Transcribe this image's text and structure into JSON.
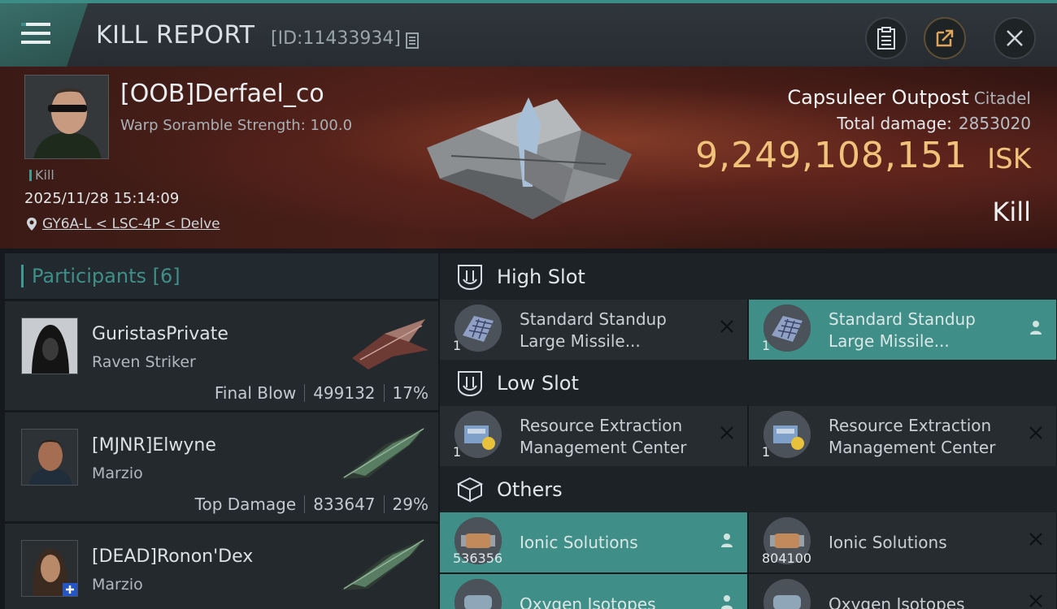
{
  "header": {
    "title": "KILL REPORT",
    "report_id": "[ID:11433934]"
  },
  "victim": {
    "pilot": "[OOB]Derfael_co",
    "scramble": "Warp Soramble Strength: 100.0",
    "kill_tag": "Kill",
    "datetime": "2025/11/28 15:14:09",
    "location": "GY6A-L < LSC-4P < Delve",
    "structure": "Capsuleer Outpost",
    "structure_class": "Citadel",
    "total_damage_label": "Total damage:",
    "total_damage": "2853020",
    "isk_value": "9,249,108,151",
    "isk_unit": "ISK",
    "result": "Kill"
  },
  "participants": {
    "label": "Participants",
    "count": "[6]",
    "rows": [
      {
        "name": "GuristasPrivate",
        "ship": "Raven Striker",
        "tag": "Final Blow",
        "damage": "499132",
        "percent": "17%"
      },
      {
        "name": "[MJNR]Elwyne",
        "ship": "Marzio",
        "tag": "Top Damage",
        "damage": "833647",
        "percent": "29%"
      },
      {
        "name": "[DEAD]Ronon'Dex",
        "ship": "Marzio"
      }
    ]
  },
  "slots": {
    "high": {
      "title": "High Slot",
      "items": [
        {
          "name1": "Standard Standup",
          "name2": "Large Missile...",
          "qty": "1"
        },
        {
          "name1": "Standard Standup",
          "name2": "Large Missile...",
          "qty": "1"
        }
      ]
    },
    "low": {
      "title": "Low Slot",
      "items": [
        {
          "name1": "Resource Extraction",
          "name2": "Management Center",
          "qty": "1"
        },
        {
          "name1": "Resource Extraction",
          "name2": "Management Center",
          "qty": "1"
        }
      ]
    },
    "others": {
      "title": "Others",
      "items": [
        {
          "name": "Ionic Solutions",
          "qty": "536356"
        },
        {
          "name": "Ionic Solutions",
          "qty": "804100"
        },
        {
          "name": "Oxygen Isotopes"
        },
        {
          "name": "Oxygen Isotopes"
        }
      ]
    }
  },
  "colors": {
    "accent": "#3f8f88",
    "isk": "#f0c27a",
    "header_bg": "#4a1f18"
  }
}
